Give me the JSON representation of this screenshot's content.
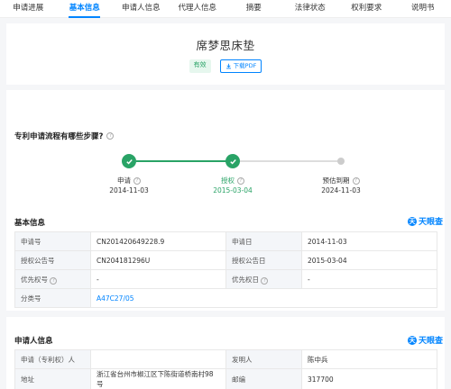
{
  "tabs": [
    "申请进展",
    "基本信息",
    "申请人信息",
    "代理人信息",
    "摘要",
    "法律状态",
    "权利要求",
    "说明书"
  ],
  "active_tab_index": 1,
  "title": "席梦思床垫",
  "status_badge": "有效",
  "pdf_button": "下载PDF",
  "flow": {
    "question": "专利申请流程有哪些步骤?",
    "steps": [
      {
        "label": "申请",
        "date": "2014-11-03",
        "done": true
      },
      {
        "label": "授权",
        "date": "2015-03-04",
        "done": true
      },
      {
        "label": "预估到期",
        "date": "2024-11-03",
        "done": false
      }
    ]
  },
  "basic": {
    "heading": "基本信息",
    "brand": "天眼查",
    "rows": [
      [
        "申请号",
        "CN201420649228.9",
        "申请日",
        "2014-11-03"
      ],
      [
        "授权公告号",
        "CN204181296U",
        "授权公告日",
        "2015-03-04"
      ],
      [
        "优先权号",
        "-",
        "优先权日",
        "-"
      ]
    ],
    "class_label": "分类号",
    "class_value": "A47C27/05"
  },
  "applicant": {
    "heading": "申请人信息",
    "brand": "天眼查",
    "rows": [
      [
        "申请（专利权）人",
        "",
        "发明人",
        "陈中兵"
      ],
      [
        "地址",
        "浙江省台州市椒江区下陈街道桥南村98号",
        "邮编",
        "317700"
      ]
    ]
  },
  "colors": {
    "accent": "#0084ff",
    "success": "#29a366"
  },
  "icons": [
    "check-icon",
    "question-icon",
    "download-icon",
    "brand-logo-icon"
  ]
}
